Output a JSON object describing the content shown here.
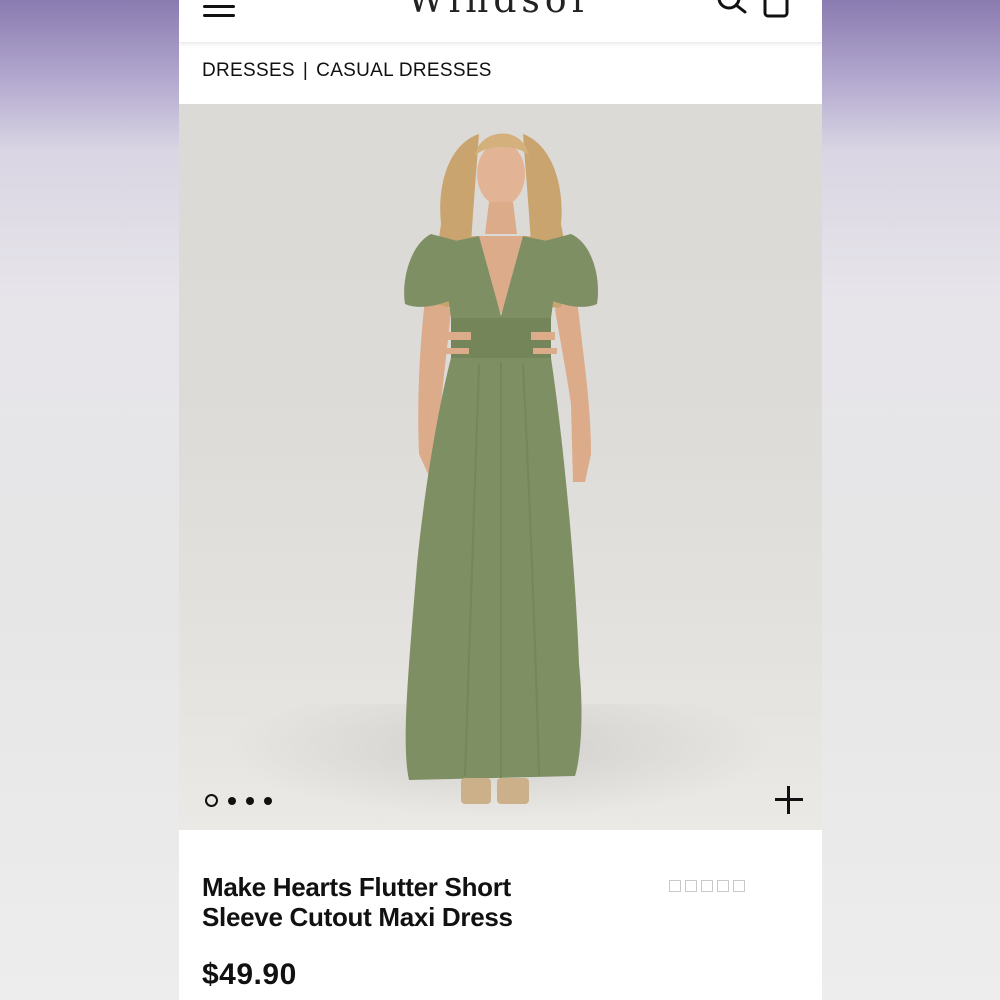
{
  "header": {
    "brand": "Windsor",
    "icons": [
      "menu-icon",
      "search-icon",
      "cart-icon"
    ]
  },
  "breadcrumb": {
    "items": [
      "DRESSES",
      "CASUAL DRESSES"
    ],
    "separator": "|"
  },
  "gallery": {
    "dots": 4,
    "active_index": 0,
    "icons": [
      "zoom-plus-icon"
    ]
  },
  "product": {
    "title": "Make Hearts Flutter Short Sleeve Cutout Maxi Dress",
    "price": "$49.90",
    "rating_stars": 5
  },
  "colors": {
    "dress": "#7f8f64",
    "background_gradient_top": "#8a7bb0",
    "text": "#111111"
  }
}
